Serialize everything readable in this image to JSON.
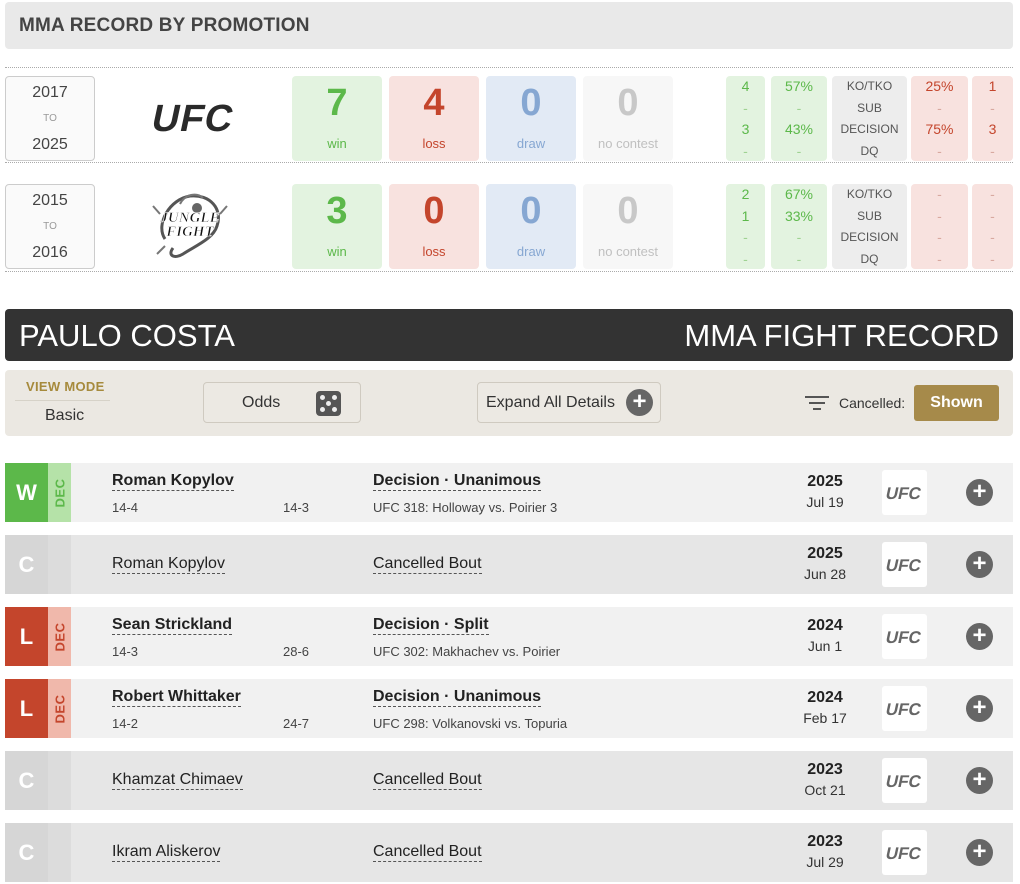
{
  "promotions_header": "MMA RECORD BY PROMOTION",
  "promotions": [
    {
      "name": "UFC",
      "logo": "ufc-logo",
      "year_start": "2017",
      "to": "TO",
      "year_end": "2025",
      "win": "7",
      "win_label": "win",
      "loss": "4",
      "loss_label": "loss",
      "draw": "0",
      "draw_label": "draw",
      "nc": "0",
      "nc_label": "no contest",
      "breakdown": [
        {
          "w_count": "4",
          "w_pct": "57%",
          "method": "KO/TKO",
          "l_pct": "25%",
          "l_count": "1"
        },
        {
          "w_count": "-",
          "w_pct": "-",
          "method": "SUB",
          "l_pct": "-",
          "l_count": "-"
        },
        {
          "w_count": "3",
          "w_pct": "43%",
          "method": "DECISION",
          "l_pct": "75%",
          "l_count": "3"
        },
        {
          "w_count": "-",
          "w_pct": "-",
          "method": "DQ",
          "l_pct": "-",
          "l_count": "-"
        }
      ]
    },
    {
      "name": "Jungle Fight",
      "logo": "jungle-fight-logo",
      "year_start": "2015",
      "to": "TO",
      "year_end": "2016",
      "win": "3",
      "win_label": "win",
      "loss": "0",
      "loss_label": "loss",
      "draw": "0",
      "draw_label": "draw",
      "nc": "0",
      "nc_label": "no contest",
      "breakdown": [
        {
          "w_count": "2",
          "w_pct": "67%",
          "method": "KO/TKO",
          "l_pct": "-",
          "l_count": "-"
        },
        {
          "w_count": "1",
          "w_pct": "33%",
          "method": "SUB",
          "l_pct": "-",
          "l_count": "-"
        },
        {
          "w_count": "-",
          "w_pct": "-",
          "method": "DECISION",
          "l_pct": "-",
          "l_count": "-"
        },
        {
          "w_count": "-",
          "w_pct": "-",
          "method": "DQ",
          "l_pct": "-",
          "l_count": "-"
        }
      ]
    }
  ],
  "fighter_bar": {
    "name": "PAULO COSTA",
    "title": "MMA FIGHT RECORD"
  },
  "controls": {
    "view_mode_label": "VIEW MODE",
    "view_mode_value": "Basic",
    "odds_label": "Odds",
    "odds_icon": "dice-icon",
    "expand_label": "Expand All Details",
    "filter_icon": "filter-icon",
    "cancelled_label": "Cancelled:",
    "shown_label": "Shown"
  },
  "fights": [
    {
      "result": "W",
      "method_tag": "DEC",
      "opponent": "Roman Kopylov",
      "rec_self": "14-4",
      "rec_opp": "14-3",
      "method": "Decision · Unanimous",
      "event": "UFC 318: Holloway vs. Poirier 3",
      "year": "2025",
      "date": "Jul 19",
      "promo_logo": "ufc-logo"
    },
    {
      "result": "C",
      "method_tag": "",
      "opponent": "Roman Kopylov",
      "rec_self": "",
      "rec_opp": "",
      "method": "Cancelled Bout",
      "event": "",
      "year": "2025",
      "date": "Jun 28",
      "promo_logo": "ufc-logo"
    },
    {
      "result": "L",
      "method_tag": "DEC",
      "opponent": "Sean Strickland",
      "rec_self": "14-3",
      "rec_opp": "28-6",
      "method": "Decision · Split",
      "event": "UFC 302: Makhachev vs. Poirier",
      "year": "2024",
      "date": "Jun 1",
      "promo_logo": "ufc-logo"
    },
    {
      "result": "L",
      "method_tag": "DEC",
      "opponent": "Robert Whittaker",
      "rec_self": "14-2",
      "rec_opp": "24-7",
      "method": "Decision · Unanimous",
      "event": "UFC 298: Volkanovski vs. Topuria",
      "year": "2024",
      "date": "Feb 17",
      "promo_logo": "ufc-logo"
    },
    {
      "result": "C",
      "method_tag": "",
      "opponent": "Khamzat Chimaev",
      "rec_self": "",
      "rec_opp": "",
      "method": "Cancelled Bout",
      "event": "",
      "year": "2023",
      "date": "Oct 21",
      "promo_logo": "ufc-logo"
    },
    {
      "result": "C",
      "method_tag": "",
      "opponent": "Ikram Aliskerov",
      "rec_self": "",
      "rec_opp": "",
      "method": "Cancelled Bout",
      "event": "",
      "year": "2023",
      "date": "Jul 29",
      "promo_logo": "ufc-logo"
    }
  ],
  "colors": {
    "win": "#5cb84a",
    "loss": "#c4452c",
    "draw": "#86a7d2",
    "cancelled": "#d6d6d6",
    "gold": "#a68a4a",
    "dark_bar": "#333333"
  }
}
